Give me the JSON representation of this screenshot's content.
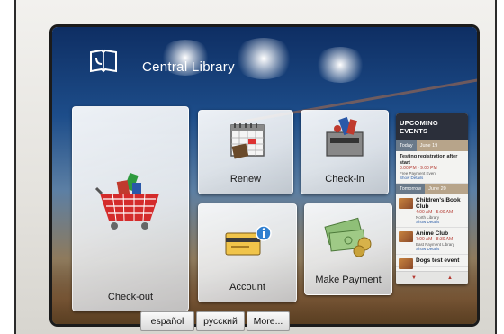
{
  "app": {
    "title": "Central Library"
  },
  "tiles": {
    "checkout": "Check-out",
    "renew": "Renew",
    "checkin": "Check-in",
    "account": "Account",
    "payment": "Make Payment"
  },
  "events": {
    "header": "UPCOMING EVENTS",
    "today_tab": "Today",
    "today_date": "June 19",
    "tomorrow_tab": "Tomorrow",
    "tomorrow_date": "June 20",
    "today_items": [
      {
        "title": "Testing registration after start",
        "time": "8:00 PM - 9:00 PM",
        "detail": "Free Payment Event",
        "link": "Show Details"
      }
    ],
    "tomorrow_items": [
      {
        "title": "Children's Book Club",
        "time": "4:00 AM - 5:00 AM",
        "detail": "North Library",
        "link": "Show Details"
      },
      {
        "title": "Anime Club",
        "time": "7:00 AM - 8:30 AM",
        "detail": "East Payment Library",
        "link": "Show Details"
      },
      {
        "title": "Dogs test event"
      }
    ]
  },
  "languages": [
    "español",
    "русский",
    "More..."
  ],
  "colors": {
    "panel_header": "#2b2f3a",
    "accent_time": "#b3372f",
    "screen_top": "#0e2e63"
  }
}
